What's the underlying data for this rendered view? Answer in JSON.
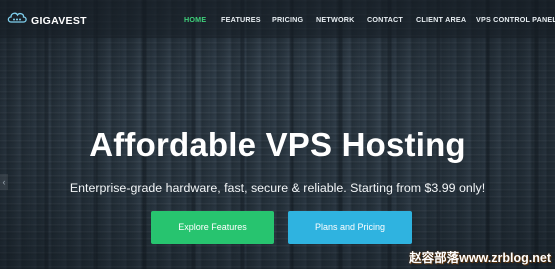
{
  "brand": {
    "name": "GIGAVEST"
  },
  "nav": {
    "items": [
      {
        "label": "HOME",
        "active": true
      },
      {
        "label": "FEATURES",
        "active": false
      },
      {
        "label": "PRICING",
        "active": false
      },
      {
        "label": "NETWORK",
        "active": false
      },
      {
        "label": "CONTACT",
        "active": false
      },
      {
        "label": "CLIENT AREA",
        "active": false
      },
      {
        "label": "VPS CONTROL PANEL",
        "active": false
      }
    ]
  },
  "hero": {
    "title": "Affordable VPS Hosting",
    "subtitle": "Enterprise-grade hardware, fast, secure & reliable. Starting from $3.99 only!",
    "buttons": [
      {
        "label": "Explore Features",
        "color": "#27c46f"
      },
      {
        "label": "Plans and Pricing",
        "color": "#2fb3e0"
      }
    ],
    "slider_prev_icon": "chevron-left-icon"
  },
  "watermark": {
    "text": "赵容部落www.zrblog.net"
  },
  "colors": {
    "accent_active": "#3ecf7a",
    "nav_text": "#e8eef2",
    "background": "#2b3843"
  }
}
